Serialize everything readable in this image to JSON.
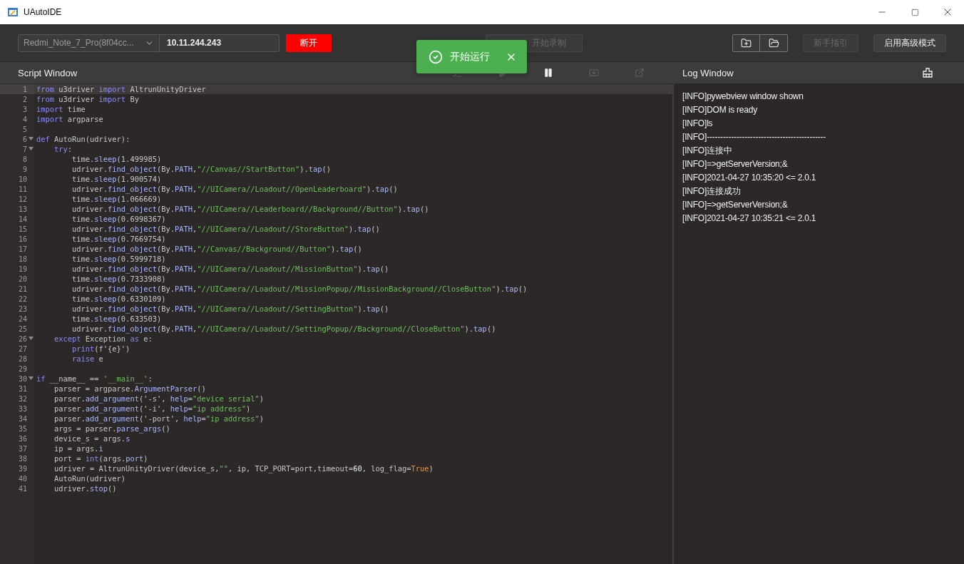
{
  "window": {
    "title": "UAutoIDE"
  },
  "toolbar": {
    "device": {
      "value": "Redmi_Note_7_Pro(8f04cc..."
    },
    "ip": {
      "value": "10.11.244.243"
    },
    "disconnect": {
      "label": "断开"
    },
    "record": {
      "label": "开始录制",
      "disabled": true
    },
    "guide": {
      "label": "新手指引",
      "disabled": true
    },
    "advanced": {
      "label": "启用高级模式",
      "disabled": false
    }
  },
  "toast": {
    "message": "开始运行"
  },
  "script_window": {
    "title": "Script Window",
    "tools": [
      {
        "kind": "list",
        "disabled": true
      },
      {
        "kind": "play",
        "disabled": true
      },
      {
        "kind": "pause",
        "disabled": false
      },
      {
        "kind": "import",
        "disabled": true
      },
      {
        "kind": "external",
        "disabled": true
      }
    ]
  },
  "code": {
    "lines": [
      {
        "number": "1",
        "current": true,
        "foldable": false,
        "tokens": [
          {
            "kind": "kw",
            "text": "from"
          },
          {
            "kind": "p",
            "text": " u3driver "
          },
          {
            "kind": "kw",
            "text": "import"
          },
          {
            "kind": "p",
            "text": " AltrunUnityDriver"
          }
        ]
      },
      {
        "number": "2",
        "current": false,
        "foldable": false,
        "tokens": [
          {
            "kind": "kw",
            "text": "from"
          },
          {
            "kind": "p",
            "text": " u3driver "
          },
          {
            "kind": "kw",
            "text": "import"
          },
          {
            "kind": "p",
            "text": " By"
          }
        ]
      },
      {
        "number": "3",
        "current": false,
        "foldable": false,
        "tokens": [
          {
            "kind": "kw",
            "text": "import"
          },
          {
            "kind": "p",
            "text": " time"
          }
        ]
      },
      {
        "number": "4",
        "current": false,
        "foldable": false,
        "tokens": [
          {
            "kind": "kw",
            "text": "import"
          },
          {
            "kind": "p",
            "text": " argparse"
          }
        ]
      },
      {
        "number": "5",
        "current": false,
        "foldable": false
      },
      {
        "number": "6",
        "current": false,
        "foldable": true,
        "tokens": [
          {
            "kind": "kw",
            "text": "def"
          },
          {
            "kind": "p",
            "text": " AutoRun(udriver):"
          }
        ]
      },
      {
        "number": "7",
        "current": false,
        "foldable": true,
        "tokens": [
          {
            "kind": "kw",
            "text": "    try"
          },
          {
            "kind": "p",
            "text": ":"
          }
        ]
      },
      {
        "number": "8",
        "current": false,
        "foldable": false,
        "tokens": [
          {
            "kind": "p",
            "text": "        time."
          },
          {
            "kind": "m",
            "text": "sleep"
          },
          {
            "kind": "p",
            "text": "(1.499985)"
          }
        ]
      },
      {
        "number": "9",
        "current": false,
        "foldable": false,
        "tokens": [
          {
            "kind": "p",
            "text": "        udriver."
          },
          {
            "kind": "m",
            "text": "find_object"
          },
          {
            "kind": "p",
            "text": "(By."
          },
          {
            "kind": "m",
            "text": "PATH"
          },
          {
            "kind": "p",
            "text": ","
          },
          {
            "kind": "s",
            "text": "\"//Canvas//StartButton\""
          },
          {
            "kind": "p",
            "text": ")."
          },
          {
            "kind": "m",
            "text": "tap"
          },
          {
            "kind": "p",
            "text": "()"
          }
        ]
      },
      {
        "number": "10",
        "current": false,
        "foldable": false,
        "tokens": [
          {
            "kind": "p",
            "text": "        time."
          },
          {
            "kind": "m",
            "text": "sleep"
          },
          {
            "kind": "p",
            "text": "(1.900574)"
          }
        ]
      },
      {
        "number": "11",
        "current": false,
        "foldable": false,
        "tokens": [
          {
            "kind": "p",
            "text": "        udriver."
          },
          {
            "kind": "m",
            "text": "find_object"
          },
          {
            "kind": "p",
            "text": "(By."
          },
          {
            "kind": "m",
            "text": "PATH"
          },
          {
            "kind": "p",
            "text": ","
          },
          {
            "kind": "s",
            "text": "\"//UICamera//Loadout//OpenLeaderboard\""
          },
          {
            "kind": "p",
            "text": ")."
          },
          {
            "kind": "m",
            "text": "tap"
          },
          {
            "kind": "p",
            "text": "()"
          }
        ]
      },
      {
        "number": "12",
        "current": false,
        "foldable": false,
        "tokens": [
          {
            "kind": "p",
            "text": "        time."
          },
          {
            "kind": "m",
            "text": "sleep"
          },
          {
            "kind": "p",
            "text": "(1.066669)"
          }
        ]
      },
      {
        "number": "13",
        "current": false,
        "foldable": false,
        "tokens": [
          {
            "kind": "p",
            "text": "        udriver."
          },
          {
            "kind": "m",
            "text": "find_object"
          },
          {
            "kind": "p",
            "text": "(By."
          },
          {
            "kind": "m",
            "text": "PATH"
          },
          {
            "kind": "p",
            "text": ","
          },
          {
            "kind": "s",
            "text": "\"//UICamera//Leaderboard//Background//Button\""
          },
          {
            "kind": "p",
            "text": ")."
          },
          {
            "kind": "m",
            "text": "tap"
          },
          {
            "kind": "p",
            "text": "()"
          }
        ]
      },
      {
        "number": "14",
        "current": false,
        "foldable": false,
        "tokens": [
          {
            "kind": "p",
            "text": "        time."
          },
          {
            "kind": "m",
            "text": "sleep"
          },
          {
            "kind": "p",
            "text": "(0.6998367)"
          }
        ]
      },
      {
        "number": "15",
        "current": false,
        "foldable": false,
        "tokens": [
          {
            "kind": "p",
            "text": "        udriver."
          },
          {
            "kind": "m",
            "text": "find_object"
          },
          {
            "kind": "p",
            "text": "(By."
          },
          {
            "kind": "m",
            "text": "PATH"
          },
          {
            "kind": "p",
            "text": ","
          },
          {
            "kind": "s",
            "text": "\"//UICamera//Loadout//StoreButton\""
          },
          {
            "kind": "p",
            "text": ")."
          },
          {
            "kind": "m",
            "text": "tap"
          },
          {
            "kind": "p",
            "text": "()"
          }
        ]
      },
      {
        "number": "16",
        "current": false,
        "foldable": false,
        "tokens": [
          {
            "kind": "p",
            "text": "        time."
          },
          {
            "kind": "m",
            "text": "sleep"
          },
          {
            "kind": "p",
            "text": "(0.7669754)"
          }
        ]
      },
      {
        "number": "17",
        "current": false,
        "foldable": false,
        "tokens": [
          {
            "kind": "p",
            "text": "        udriver."
          },
          {
            "kind": "m",
            "text": "find_object"
          },
          {
            "kind": "p",
            "text": "(By."
          },
          {
            "kind": "m",
            "text": "PATH"
          },
          {
            "kind": "p",
            "text": ","
          },
          {
            "kind": "s",
            "text": "\"//Canvas//Background//Button\""
          },
          {
            "kind": "p",
            "text": ")."
          },
          {
            "kind": "m",
            "text": "tap"
          },
          {
            "kind": "p",
            "text": "()"
          }
        ]
      },
      {
        "number": "18",
        "current": false,
        "foldable": false,
        "tokens": [
          {
            "kind": "p",
            "text": "        time."
          },
          {
            "kind": "m",
            "text": "sleep"
          },
          {
            "kind": "p",
            "text": "(0.5999718)"
          }
        ]
      },
      {
        "number": "19",
        "current": false,
        "foldable": false,
        "tokens": [
          {
            "kind": "p",
            "text": "        udriver."
          },
          {
            "kind": "m",
            "text": "find_object"
          },
          {
            "kind": "p",
            "text": "(By."
          },
          {
            "kind": "m",
            "text": "PATH"
          },
          {
            "kind": "p",
            "text": ","
          },
          {
            "kind": "s",
            "text": "\"//UICamera//Loadout//MissionButton\""
          },
          {
            "kind": "p",
            "text": ")."
          },
          {
            "kind": "m",
            "text": "tap"
          },
          {
            "kind": "p",
            "text": "()"
          }
        ]
      },
      {
        "number": "20",
        "current": false,
        "foldable": false,
        "tokens": [
          {
            "kind": "p",
            "text": "        time."
          },
          {
            "kind": "m",
            "text": "sleep"
          },
          {
            "kind": "p",
            "text": "(0.7333908)"
          }
        ]
      },
      {
        "number": "21",
        "current": false,
        "foldable": false,
        "tokens": [
          {
            "kind": "p",
            "text": "        udriver."
          },
          {
            "kind": "m",
            "text": "find_object"
          },
          {
            "kind": "p",
            "text": "(By."
          },
          {
            "kind": "m",
            "text": "PATH"
          },
          {
            "kind": "p",
            "text": ","
          },
          {
            "kind": "s",
            "text": "\"//UICamera//Loadout//MissionPopup//MissionBackground//CloseButton\""
          },
          {
            "kind": "p",
            "text": ")."
          },
          {
            "kind": "m",
            "text": "tap"
          },
          {
            "kind": "p",
            "text": "()"
          }
        ]
      },
      {
        "number": "22",
        "current": false,
        "foldable": false,
        "tokens": [
          {
            "kind": "p",
            "text": "        time."
          },
          {
            "kind": "m",
            "text": "sleep"
          },
          {
            "kind": "p",
            "text": "(0.6330109)"
          }
        ]
      },
      {
        "number": "23",
        "current": false,
        "foldable": false,
        "tokens": [
          {
            "kind": "p",
            "text": "        udriver."
          },
          {
            "kind": "m",
            "text": "find_object"
          },
          {
            "kind": "p",
            "text": "(By."
          },
          {
            "kind": "m",
            "text": "PATH"
          },
          {
            "kind": "p",
            "text": ","
          },
          {
            "kind": "s",
            "text": "\"//UICamera//Loadout//SettingButton\""
          },
          {
            "kind": "p",
            "text": ")."
          },
          {
            "kind": "m",
            "text": "tap"
          },
          {
            "kind": "p",
            "text": "()"
          }
        ]
      },
      {
        "number": "24",
        "current": false,
        "foldable": false,
        "tokens": [
          {
            "kind": "p",
            "text": "        time."
          },
          {
            "kind": "m",
            "text": "sleep"
          },
          {
            "kind": "p",
            "text": "(0.633503)"
          }
        ]
      },
      {
        "number": "25",
        "current": false,
        "foldable": false,
        "tokens": [
          {
            "kind": "p",
            "text": "        udriver."
          },
          {
            "kind": "m",
            "text": "find_object"
          },
          {
            "kind": "p",
            "text": "(By."
          },
          {
            "kind": "m",
            "text": "PATH"
          },
          {
            "kind": "p",
            "text": ","
          },
          {
            "kind": "s",
            "text": "\"//UICamera//Loadout//SettingPopup//Background//CloseButton\""
          },
          {
            "kind": "p",
            "text": ")."
          },
          {
            "kind": "m",
            "text": "tap"
          },
          {
            "kind": "p",
            "text": "()"
          }
        ]
      },
      {
        "number": "26",
        "current": false,
        "foldable": true,
        "tokens": [
          {
            "kind": "kw",
            "text": "    except"
          },
          {
            "kind": "p",
            "text": " Exception "
          },
          {
            "kind": "kw",
            "text": "as"
          },
          {
            "kind": "p",
            "text": " e:"
          }
        ]
      },
      {
        "number": "27",
        "current": false,
        "foldable": false,
        "tokens": [
          {
            "kind": "kw",
            "text": "        print"
          },
          {
            "kind": "p",
            "text": "(f'{e}')"
          }
        ]
      },
      {
        "number": "28",
        "current": false,
        "foldable": false,
        "tokens": [
          {
            "kind": "kw",
            "text": "        raise"
          },
          {
            "kind": "p",
            "text": " e"
          }
        ]
      },
      {
        "number": "29",
        "current": false,
        "foldable": false
      },
      {
        "number": "30",
        "current": false,
        "foldable": true,
        "tokens": [
          {
            "kind": "kw",
            "text": "if"
          },
          {
            "kind": "p",
            "text": " __name__ == "
          },
          {
            "kind": "s",
            "text": "'__main__'"
          },
          {
            "kind": "p",
            "text": ":"
          }
        ]
      },
      {
        "number": "31",
        "current": false,
        "foldable": false,
        "tokens": [
          {
            "kind": "p",
            "text": "    parser = argparse."
          },
          {
            "kind": "m",
            "text": "ArgumentParser"
          },
          {
            "kind": "p",
            "text": "()"
          }
        ]
      },
      {
        "number": "32",
        "current": false,
        "foldable": false,
        "tokens": [
          {
            "kind": "p",
            "text": "    parser."
          },
          {
            "kind": "m",
            "text": "add_argument"
          },
          {
            "kind": "p",
            "text": "('-s', "
          },
          {
            "kind": "m",
            "text": "help"
          },
          {
            "kind": "p",
            "text": "="
          },
          {
            "kind": "s",
            "text": "\"device serial\""
          },
          {
            "kind": "p",
            "text": ")"
          }
        ]
      },
      {
        "number": "33",
        "current": false,
        "foldable": false,
        "tokens": [
          {
            "kind": "p",
            "text": "    parser."
          },
          {
            "kind": "m",
            "text": "add_argument"
          },
          {
            "kind": "p",
            "text": "('-i', "
          },
          {
            "kind": "m",
            "text": "help"
          },
          {
            "kind": "p",
            "text": "="
          },
          {
            "kind": "s",
            "text": "\"ip address\""
          },
          {
            "kind": "p",
            "text": ")"
          }
        ]
      },
      {
        "number": "34",
        "current": false,
        "foldable": false,
        "tokens": [
          {
            "kind": "p",
            "text": "    parser."
          },
          {
            "kind": "m",
            "text": "add_argument"
          },
          {
            "kind": "p",
            "text": "('-port', "
          },
          {
            "kind": "m",
            "text": "help"
          },
          {
            "kind": "p",
            "text": "="
          },
          {
            "kind": "s",
            "text": "\"ip address\""
          },
          {
            "kind": "p",
            "text": ")"
          }
        ]
      },
      {
        "number": "35",
        "current": false,
        "foldable": false,
        "tokens": [
          {
            "kind": "p",
            "text": "    args = parser."
          },
          {
            "kind": "m",
            "text": "parse_args"
          },
          {
            "kind": "p",
            "text": "()"
          }
        ]
      },
      {
        "number": "36",
        "current": false,
        "foldable": false,
        "tokens": [
          {
            "kind": "p",
            "text": "    device_s = args."
          },
          {
            "kind": "m",
            "text": "s"
          }
        ]
      },
      {
        "number": "37",
        "current": false,
        "foldable": false,
        "tokens": [
          {
            "kind": "p",
            "text": "    ip = args."
          },
          {
            "kind": "m",
            "text": "i"
          }
        ]
      },
      {
        "number": "38",
        "current": false,
        "foldable": false,
        "tokens": [
          {
            "kind": "p",
            "text": "    port = "
          },
          {
            "kind": "kw",
            "text": "int"
          },
          {
            "kind": "p",
            "text": "(args."
          },
          {
            "kind": "m",
            "text": "port"
          },
          {
            "kind": "p",
            "text": ")"
          }
        ]
      },
      {
        "number": "39",
        "current": false,
        "foldable": false,
        "tokens": [
          {
            "kind": "p",
            "text": "    udriver = AltrunUnityDriver(device_s,"
          },
          {
            "kind": "s",
            "text": "\"\""
          },
          {
            "kind": "p",
            "text": ", ip, TCP_PORT=port,timeout="
          },
          {
            "kind": "num",
            "text": "60"
          },
          {
            "kind": "p",
            "text": ", log_flag="
          },
          {
            "kind": "const",
            "text": "True"
          },
          {
            "kind": "p",
            "text": ")"
          }
        ]
      },
      {
        "number": "40",
        "current": false,
        "foldable": false,
        "tokens": [
          {
            "kind": "p",
            "text": "    AutoRun(udriver)"
          }
        ]
      },
      {
        "number": "41",
        "current": false,
        "foldable": false,
        "tokens": [
          {
            "kind": "p",
            "text": "    udriver."
          },
          {
            "kind": "m",
            "text": "stop"
          },
          {
            "kind": "p",
            "text": "()"
          }
        ]
      }
    ]
  },
  "log_window": {
    "title": "Log Window",
    "lines": [
      "[INFO]pywebview window shown",
      "[INFO]DOM is ready",
      "[INFO]ls",
      "[INFO]--------------------------------------------",
      "[INFO]连接中",
      "[INFO]=>getServerVersion;&",
      "[INFO]2021-04-27 10:35:20 <= 2.0.1",
      "[INFO]连接成功",
      "[INFO]=>getServerVersion;&",
      "[INFO]2021-04-27 10:35:21 <= 2.0.1"
    ]
  }
}
